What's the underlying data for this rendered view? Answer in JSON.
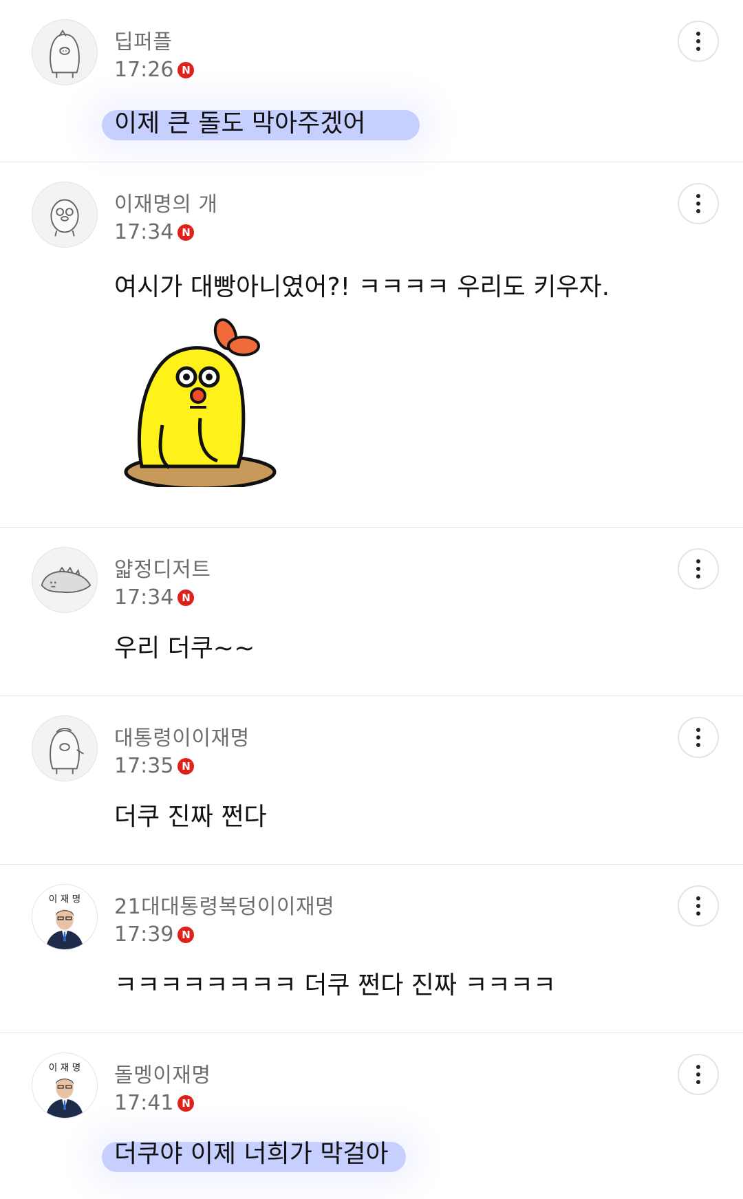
{
  "comments": [
    {
      "name": "딥퍼플",
      "time": "17:26",
      "badge": "N",
      "text": "이제 큰 돌도 막아주겠어",
      "avatar_icon": "penguin-avatar-icon",
      "highlighted": true
    },
    {
      "name": "이재명의 개",
      "time": "17:34",
      "badge": "N",
      "text": "여시가 대빵아니였어?! ㅋㅋㅋㅋ 우리도 키우자.",
      "avatar_icon": "bird-avatar-icon",
      "sticker": "yellow-chick-sticker"
    },
    {
      "name": "얇정디저트",
      "time": "17:34",
      "badge": "N",
      "text": "우리 더쿠~~",
      "avatar_icon": "dinosaur-avatar-icon"
    },
    {
      "name": "대통령이이재명",
      "time": "17:35",
      "badge": "N",
      "text": "더쿠 진짜 쩐다",
      "avatar_icon": "penguin-avatar-icon"
    },
    {
      "name": "21대대통령복덩이이재명",
      "time": "17:39",
      "badge": "N",
      "text": "ㅋㅋㅋㅋㅋㅋㅋㅋ 더쿠 쩐다 진짜 ㅋㅋㅋㅋ",
      "avatar_icon": "politician-photo-avatar",
      "avatar_text": "이 재 명"
    },
    {
      "name": "돌멩이재명",
      "time": "17:41",
      "badge": "N",
      "text": "더쿠야 이제 너희가 막걸아",
      "avatar_icon": "politician-photo-avatar",
      "avatar_text": "이 재 명",
      "highlighted": true
    }
  ],
  "colors": {
    "highlight": "#9aa9ff",
    "badge": "#e0201b",
    "meta_text": "#6d6d6d"
  }
}
